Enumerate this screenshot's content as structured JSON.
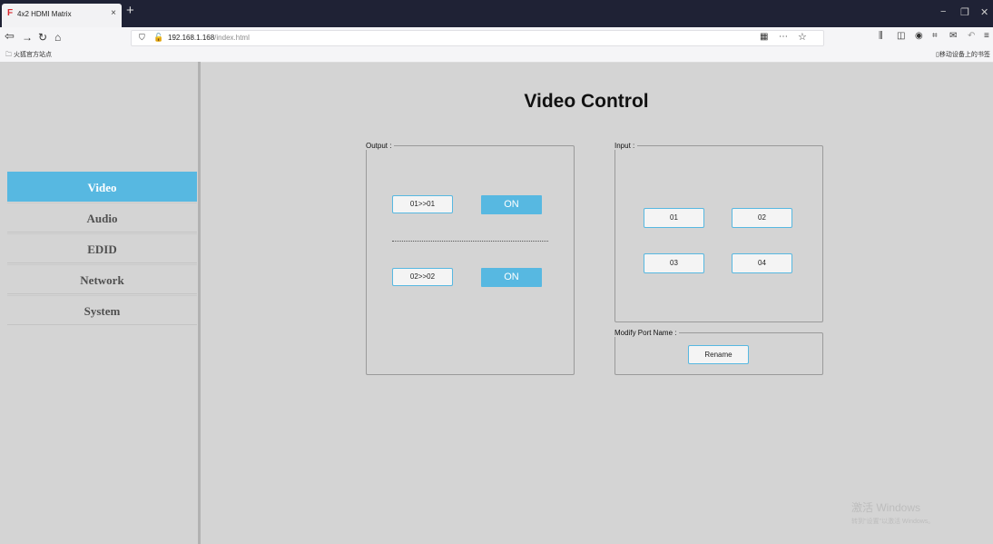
{
  "browser": {
    "tab_title": "4x2 HDMI Matrix",
    "tab_favicon": "F",
    "tab_close": "×",
    "new_tab": "+",
    "url_host": "192.168.1.168",
    "url_path": "/index.html",
    "bookmark_folder": "火狐官方站点",
    "mobile_bookmarks": "移动设备上的书签",
    "window_controls": [
      "−",
      "❐",
      "✕"
    ]
  },
  "sidebar": {
    "items": [
      {
        "label": "Video",
        "active": true
      },
      {
        "label": "Audio",
        "active": false
      },
      {
        "label": "EDID",
        "active": false
      },
      {
        "label": "Network",
        "active": false
      },
      {
        "label": "System",
        "active": false
      }
    ]
  },
  "main": {
    "title": "Video Control",
    "output": {
      "legend": "Output :",
      "routes": [
        {
          "label": "01>>01",
          "state": "ON"
        },
        {
          "label": "02>>02",
          "state": "ON"
        }
      ]
    },
    "input": {
      "legend": "Input :",
      "ports": [
        "01",
        "02",
        "03",
        "04"
      ]
    },
    "modify": {
      "legend": "Modify Port Name :",
      "rename_label": "Rename"
    }
  },
  "watermark": {
    "line1": "激活 Windows",
    "line2": "转到\"设置\"以激活 Windows。"
  },
  "colors": {
    "accent": "#57b8e1",
    "page_bg": "#d4d4d4",
    "tabbar_bg": "#1f2235"
  }
}
